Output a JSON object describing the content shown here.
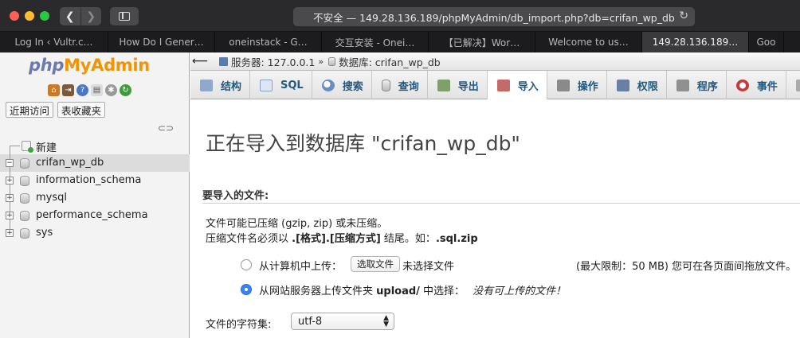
{
  "browser": {
    "url": "不安全 — 149.28.136.189/phpMyAdmin/db_import.php?db=crifan_wp_db",
    "tabs": [
      {
        "label": "Log In ‹ Vultr.c…",
        "width": 136
      },
      {
        "label": "How Do I Gener…",
        "width": 134
      },
      {
        "label": "oneinstack - G…",
        "width": 134
      },
      {
        "label": "交互安装 - Onei…",
        "width": 134
      },
      {
        "label": "【已解决】Wor…",
        "width": 134
      },
      {
        "label": "Welcome to us…",
        "width": 134
      },
      {
        "label": "149.28.136.189…",
        "width": 134,
        "active": true
      },
      {
        "label": "Goo",
        "width": 44
      }
    ]
  },
  "sidebar": {
    "logo_php": "php",
    "logo_my": "My",
    "logo_admin": "Admin",
    "recent_btn": "近期访问",
    "favorites_btn": "表收藏夹",
    "new_label": "新建",
    "databases": [
      {
        "name": "crifan_wp_db",
        "expanded": true,
        "active": true
      },
      {
        "name": "information_schema",
        "expanded": false
      },
      {
        "name": "mysql",
        "expanded": false
      },
      {
        "name": "performance_schema",
        "expanded": false
      },
      {
        "name": "sys",
        "expanded": false
      }
    ]
  },
  "breadcrumb": {
    "server": "服务器: 127.0.0.1",
    "database": "数据库: crifan_wp_db"
  },
  "tabs": [
    {
      "label": "结构",
      "icon": "structure"
    },
    {
      "label": "SQL",
      "icon": "sql"
    },
    {
      "label": "搜索",
      "icon": "search"
    },
    {
      "label": "查询",
      "icon": "query"
    },
    {
      "label": "导出",
      "icon": "export"
    },
    {
      "label": "导入",
      "icon": "import",
      "active": true
    },
    {
      "label": "操作",
      "icon": "ops"
    },
    {
      "label": "权限",
      "icon": "priv"
    },
    {
      "label": "程序",
      "icon": "routine"
    },
    {
      "label": "事件",
      "icon": "event"
    }
  ],
  "main": {
    "title": "正在导入到数据库 \"crifan_wp_db\"",
    "section_head": "要导入的文件:",
    "note1": "文件可能已压缩 (gzip, zip) 或未压缩。",
    "note2_prefix": "压缩文件名必须以 ",
    "note2_bold1": ".[格式].[压缩方式]",
    "note2_mid": " 结尾。如：",
    "note2_bold2": ".sql.zip",
    "upload_local_label": "从计算机中上传：",
    "file_button": "选取文件",
    "no_file": "未选择文件",
    "max_limit": "(最大限制：50 MB) 您可在各页面间拖放文件。",
    "upload_server_prefix": "从网站服务器上传文件夹 ",
    "upload_server_dir": "upload/",
    "upload_server_suffix": " 中选择：",
    "no_files_msg": "没有可上传的文件！",
    "charset_label": "文件的字符集:",
    "charset_value": "utf-8"
  }
}
